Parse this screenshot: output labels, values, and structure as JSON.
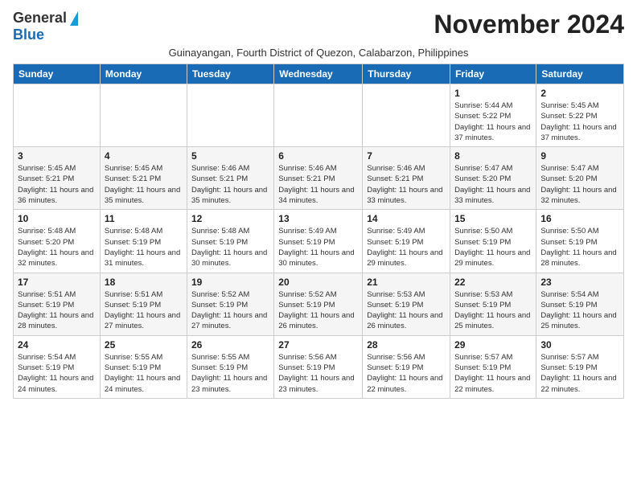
{
  "logo": {
    "general": "General",
    "blue": "Blue"
  },
  "title": "November 2024",
  "subtitle": "Guinayangan, Fourth District of Quezon, Calabarzon, Philippines",
  "headers": [
    "Sunday",
    "Monday",
    "Tuesday",
    "Wednesday",
    "Thursday",
    "Friday",
    "Saturday"
  ],
  "weeks": [
    [
      {
        "day": "",
        "sunrise": "",
        "sunset": "",
        "daylight": ""
      },
      {
        "day": "",
        "sunrise": "",
        "sunset": "",
        "daylight": ""
      },
      {
        "day": "",
        "sunrise": "",
        "sunset": "",
        "daylight": ""
      },
      {
        "day": "",
        "sunrise": "",
        "sunset": "",
        "daylight": ""
      },
      {
        "day": "",
        "sunrise": "",
        "sunset": "",
        "daylight": ""
      },
      {
        "day": "1",
        "sunrise": "Sunrise: 5:44 AM",
        "sunset": "Sunset: 5:22 PM",
        "daylight": "Daylight: 11 hours and 37 minutes."
      },
      {
        "day": "2",
        "sunrise": "Sunrise: 5:45 AM",
        "sunset": "Sunset: 5:22 PM",
        "daylight": "Daylight: 11 hours and 37 minutes."
      }
    ],
    [
      {
        "day": "3",
        "sunrise": "Sunrise: 5:45 AM",
        "sunset": "Sunset: 5:21 PM",
        "daylight": "Daylight: 11 hours and 36 minutes."
      },
      {
        "day": "4",
        "sunrise": "Sunrise: 5:45 AM",
        "sunset": "Sunset: 5:21 PM",
        "daylight": "Daylight: 11 hours and 35 minutes."
      },
      {
        "day": "5",
        "sunrise": "Sunrise: 5:46 AM",
        "sunset": "Sunset: 5:21 PM",
        "daylight": "Daylight: 11 hours and 35 minutes."
      },
      {
        "day": "6",
        "sunrise": "Sunrise: 5:46 AM",
        "sunset": "Sunset: 5:21 PM",
        "daylight": "Daylight: 11 hours and 34 minutes."
      },
      {
        "day": "7",
        "sunrise": "Sunrise: 5:46 AM",
        "sunset": "Sunset: 5:21 PM",
        "daylight": "Daylight: 11 hours and 33 minutes."
      },
      {
        "day": "8",
        "sunrise": "Sunrise: 5:47 AM",
        "sunset": "Sunset: 5:20 PM",
        "daylight": "Daylight: 11 hours and 33 minutes."
      },
      {
        "day": "9",
        "sunrise": "Sunrise: 5:47 AM",
        "sunset": "Sunset: 5:20 PM",
        "daylight": "Daylight: 11 hours and 32 minutes."
      }
    ],
    [
      {
        "day": "10",
        "sunrise": "Sunrise: 5:48 AM",
        "sunset": "Sunset: 5:20 PM",
        "daylight": "Daylight: 11 hours and 32 minutes."
      },
      {
        "day": "11",
        "sunrise": "Sunrise: 5:48 AM",
        "sunset": "Sunset: 5:19 PM",
        "daylight": "Daylight: 11 hours and 31 minutes."
      },
      {
        "day": "12",
        "sunrise": "Sunrise: 5:48 AM",
        "sunset": "Sunset: 5:19 PM",
        "daylight": "Daylight: 11 hours and 30 minutes."
      },
      {
        "day": "13",
        "sunrise": "Sunrise: 5:49 AM",
        "sunset": "Sunset: 5:19 PM",
        "daylight": "Daylight: 11 hours and 30 minutes."
      },
      {
        "day": "14",
        "sunrise": "Sunrise: 5:49 AM",
        "sunset": "Sunset: 5:19 PM",
        "daylight": "Daylight: 11 hours and 29 minutes."
      },
      {
        "day": "15",
        "sunrise": "Sunrise: 5:50 AM",
        "sunset": "Sunset: 5:19 PM",
        "daylight": "Daylight: 11 hours and 29 minutes."
      },
      {
        "day": "16",
        "sunrise": "Sunrise: 5:50 AM",
        "sunset": "Sunset: 5:19 PM",
        "daylight": "Daylight: 11 hours and 28 minutes."
      }
    ],
    [
      {
        "day": "17",
        "sunrise": "Sunrise: 5:51 AM",
        "sunset": "Sunset: 5:19 PM",
        "daylight": "Daylight: 11 hours and 28 minutes."
      },
      {
        "day": "18",
        "sunrise": "Sunrise: 5:51 AM",
        "sunset": "Sunset: 5:19 PM",
        "daylight": "Daylight: 11 hours and 27 minutes."
      },
      {
        "day": "19",
        "sunrise": "Sunrise: 5:52 AM",
        "sunset": "Sunset: 5:19 PM",
        "daylight": "Daylight: 11 hours and 27 minutes."
      },
      {
        "day": "20",
        "sunrise": "Sunrise: 5:52 AM",
        "sunset": "Sunset: 5:19 PM",
        "daylight": "Daylight: 11 hours and 26 minutes."
      },
      {
        "day": "21",
        "sunrise": "Sunrise: 5:53 AM",
        "sunset": "Sunset: 5:19 PM",
        "daylight": "Daylight: 11 hours and 26 minutes."
      },
      {
        "day": "22",
        "sunrise": "Sunrise: 5:53 AM",
        "sunset": "Sunset: 5:19 PM",
        "daylight": "Daylight: 11 hours and 25 minutes."
      },
      {
        "day": "23",
        "sunrise": "Sunrise: 5:54 AM",
        "sunset": "Sunset: 5:19 PM",
        "daylight": "Daylight: 11 hours and 25 minutes."
      }
    ],
    [
      {
        "day": "24",
        "sunrise": "Sunrise: 5:54 AM",
        "sunset": "Sunset: 5:19 PM",
        "daylight": "Daylight: 11 hours and 24 minutes."
      },
      {
        "day": "25",
        "sunrise": "Sunrise: 5:55 AM",
        "sunset": "Sunset: 5:19 PM",
        "daylight": "Daylight: 11 hours and 24 minutes."
      },
      {
        "day": "26",
        "sunrise": "Sunrise: 5:55 AM",
        "sunset": "Sunset: 5:19 PM",
        "daylight": "Daylight: 11 hours and 23 minutes."
      },
      {
        "day": "27",
        "sunrise": "Sunrise: 5:56 AM",
        "sunset": "Sunset: 5:19 PM",
        "daylight": "Daylight: 11 hours and 23 minutes."
      },
      {
        "day": "28",
        "sunrise": "Sunrise: 5:56 AM",
        "sunset": "Sunset: 5:19 PM",
        "daylight": "Daylight: 11 hours and 22 minutes."
      },
      {
        "day": "29",
        "sunrise": "Sunrise: 5:57 AM",
        "sunset": "Sunset: 5:19 PM",
        "daylight": "Daylight: 11 hours and 22 minutes."
      },
      {
        "day": "30",
        "sunrise": "Sunrise: 5:57 AM",
        "sunset": "Sunset: 5:19 PM",
        "daylight": "Daylight: 11 hours and 22 minutes."
      }
    ]
  ]
}
